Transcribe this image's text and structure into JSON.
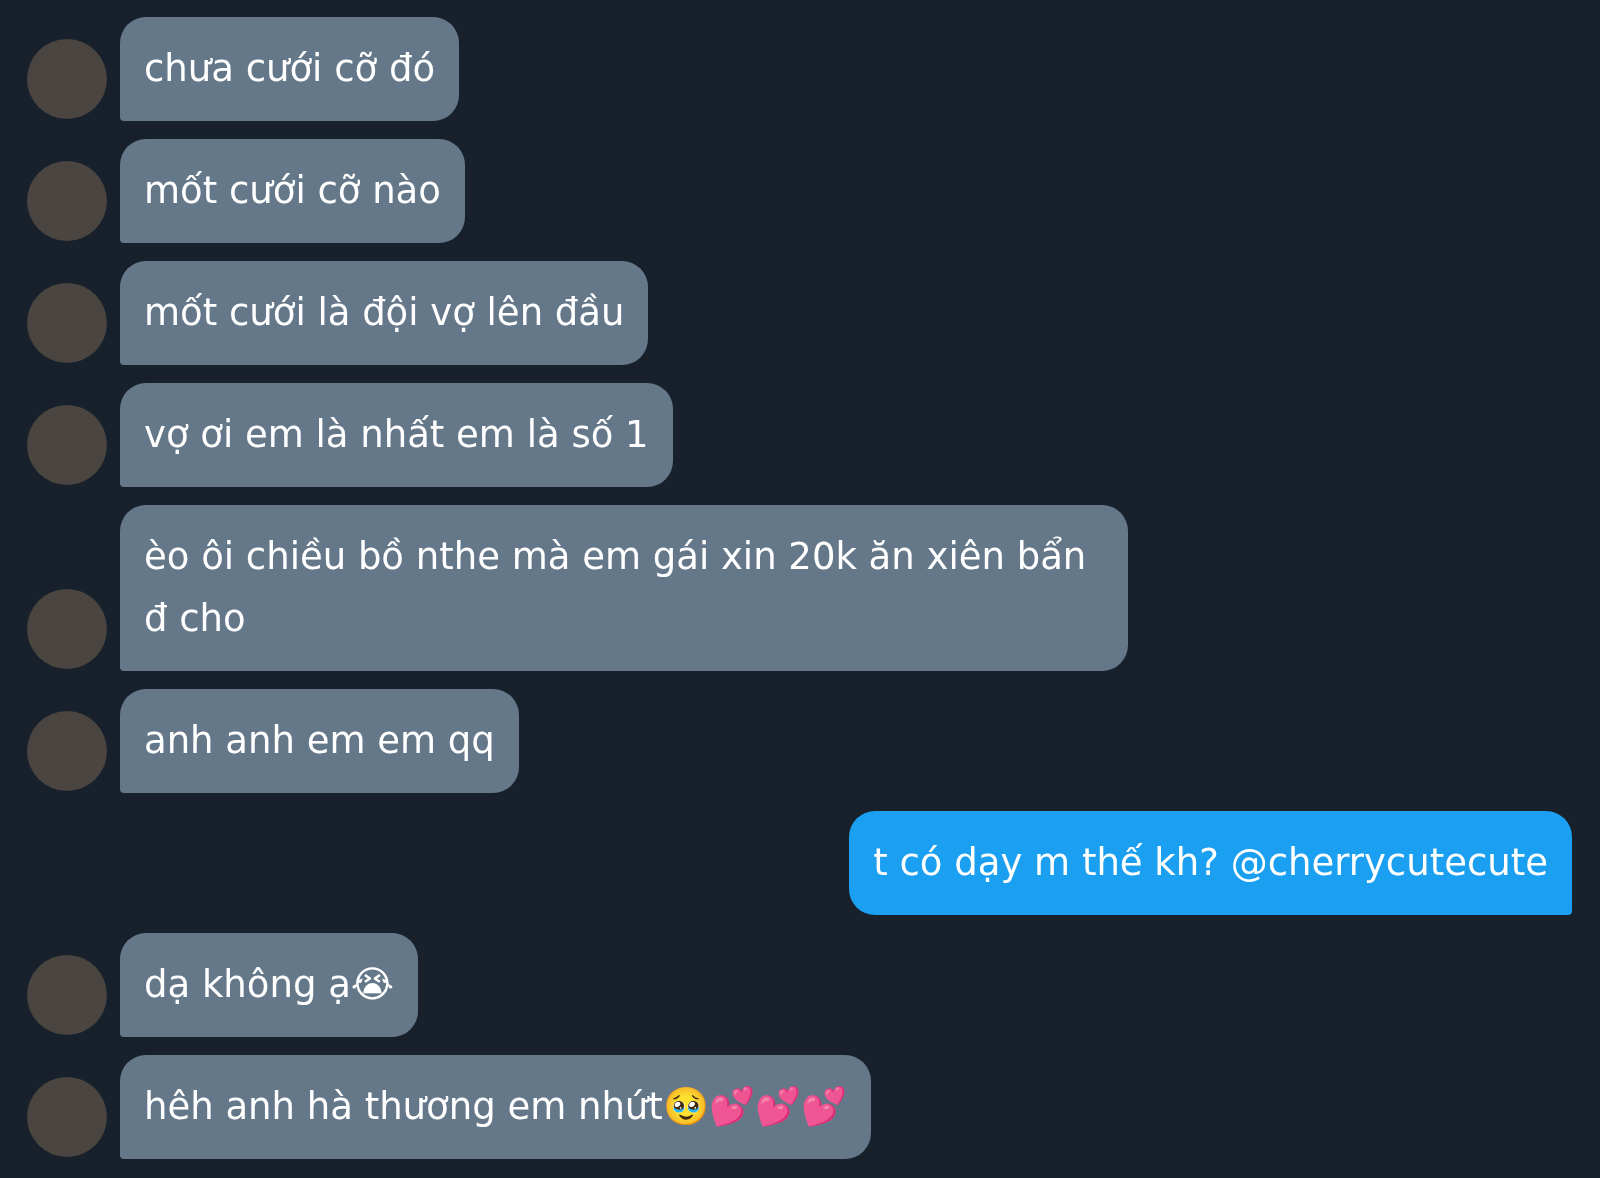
{
  "messages": [
    {
      "kind": "incoming",
      "text": "chưa cưới cỡ đó"
    },
    {
      "kind": "incoming",
      "text": "mốt cưới cỡ nào"
    },
    {
      "kind": "incoming",
      "text": "mốt cưới là đội vợ lên đầu"
    },
    {
      "kind": "incoming",
      "text": "vợ ơi em là nhất em là số 1"
    },
    {
      "kind": "incoming",
      "text": "èo ôi chiều bồ nthe mà em gái xin 20k ăn xiên bẩn đ cho"
    },
    {
      "kind": "incoming",
      "text": "anh anh em em qq"
    },
    {
      "kind": "outgoing",
      "text": "t có dạy m thế kh? @cherrycutecute"
    },
    {
      "kind": "incoming",
      "text": "dạ không ạ😭"
    },
    {
      "kind": "incoming",
      "text": "hêh anh hà thương em nhứt🥹💕💕💕"
    }
  ]
}
